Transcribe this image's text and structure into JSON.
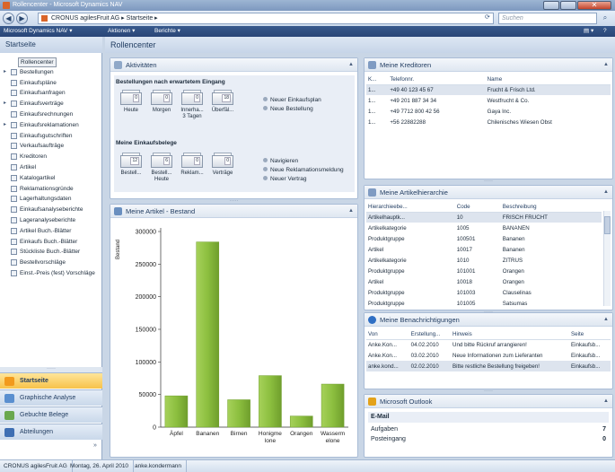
{
  "window": {
    "title": "Rollencenter - Microsoft Dynamics NAV"
  },
  "address": {
    "path": "CRONUS agilesFruit AG  ▸  Startseite  ▸",
    "search_placeholder": "Suchen"
  },
  "commandbar": {
    "app": "Microsoft Dynamics NAV ▾",
    "actions": "Aktionen ▾",
    "reports": "Berichte ▾"
  },
  "leftpane": {
    "title": "Startseite",
    "items": [
      {
        "label": "Rollencenter",
        "arrow": ""
      },
      {
        "label": "Bestellungen",
        "arrow": "▸"
      },
      {
        "label": "Einkaufspläne",
        "arrow": ""
      },
      {
        "label": "Einkaufsanfragen",
        "arrow": ""
      },
      {
        "label": "Einkaufsverträge",
        "arrow": "▸"
      },
      {
        "label": "Einkaufsrechnungen",
        "arrow": ""
      },
      {
        "label": "Einkaufsreklamationen",
        "arrow": "▸"
      },
      {
        "label": "Einkaufsgutschriften",
        "arrow": ""
      },
      {
        "label": "Verkaufsaufträge",
        "arrow": ""
      },
      {
        "label": "Kreditoren",
        "arrow": ""
      },
      {
        "label": "Artikel",
        "arrow": ""
      },
      {
        "label": "Katalogartikel",
        "arrow": ""
      },
      {
        "label": "Reklamationsgründe",
        "arrow": ""
      },
      {
        "label": "Lagerhaltungsdaten",
        "arrow": ""
      },
      {
        "label": "Einkaufsanalyseberichte",
        "arrow": ""
      },
      {
        "label": "Lageranalyseberichte",
        "arrow": ""
      },
      {
        "label": "Artikel Buch.-Blätter",
        "arrow": ""
      },
      {
        "label": "Einkaufs Buch.-Blätter",
        "arrow": ""
      },
      {
        "label": "Stückliste Buch.-Blätter",
        "arrow": ""
      },
      {
        "label": "Bestellvorschläge",
        "arrow": ""
      },
      {
        "label": "Einst.-Preis (fest) Vorschläge",
        "arrow": ""
      }
    ],
    "groups": [
      {
        "label": "Startseite",
        "color": "#f29a1c"
      },
      {
        "label": "Graphische Analyse",
        "color": "#5a8fcf"
      },
      {
        "label": "Gebuchte Belege",
        "color": "#6aa84f"
      },
      {
        "label": "Abteilungen",
        "color": "#3f6fb3"
      }
    ]
  },
  "content": {
    "title": "Rollencenter"
  },
  "activities": {
    "title": "Aktivitäten",
    "section1": "Bestellungen nach erwartetem Eingang",
    "cues1": [
      {
        "label": "Heute",
        "value": "0"
      },
      {
        "label": "Morgen",
        "value": "0"
      },
      {
        "label": "Innerha... 3 Tagen",
        "value": "0"
      },
      {
        "label": "Überfäl...",
        "value": "18"
      }
    ],
    "actions1": [
      "Neuer Einkaufsplan",
      "Neue Bestellung"
    ],
    "section2": "Meine Einkaufsbelege",
    "cues2": [
      {
        "label": "Bestell...",
        "value": "12"
      },
      {
        "label": "Bestell... Heute",
        "value": "6"
      },
      {
        "label": "Reklam...",
        "value": "0"
      },
      {
        "label": "Verträge",
        "value": "0"
      }
    ],
    "actions2": [
      "Navigieren",
      "Neue Reklamationsmeldung",
      "Neuer Vertrag"
    ]
  },
  "vendors": {
    "title": "Meine Kreditoren",
    "columns": [
      "K...",
      "Telefonnr.",
      "Name"
    ],
    "rows": [
      [
        "1...",
        "+49 40 123 45 67",
        "Frucht & Frisch Ltd."
      ],
      [
        "1...",
        "+49 201 887 34 34",
        "Westfrucht & Co."
      ],
      [
        "1...",
        "+49 7712 800 42 56",
        "Gaya Inc."
      ],
      [
        "1...",
        "+56 22882288",
        "Chilenisches Wiesen Obst"
      ]
    ]
  },
  "hierarchy": {
    "title": "Meine Artikelhierarchie",
    "columns": [
      "Hierarchieebe...",
      "Code",
      "Beschreibung"
    ],
    "rows": [
      [
        "Artikelhauptk...",
        "10",
        "FRISCH FRUCHT"
      ],
      [
        "Artikelkategorie",
        "1005",
        "BANANEN"
      ],
      [
        "Produktgruppe",
        "100501",
        "Bananen"
      ],
      [
        "Artikel",
        "10017",
        "Bananen"
      ],
      [
        "Artikelkategorie",
        "1010",
        "ZITRUS"
      ],
      [
        "Produktgruppe",
        "101001",
        "Orangen"
      ],
      [
        "Artikel",
        "10018",
        "Orangen"
      ],
      [
        "Produktgruppe",
        "101003",
        "Clauselinas"
      ],
      [
        "Produktgruppe",
        "101005",
        "Satsumas"
      ]
    ]
  },
  "notifications": {
    "title": "Meine Benachrichtigungen",
    "columns": [
      "Von",
      "Erstellung...",
      "Hinweis",
      "Seite"
    ],
    "rows": [
      [
        "Anke.Kon...",
        "04.02.2010",
        "Und bitte Rückruf arrangieren!",
        "Einkaufsb..."
      ],
      [
        "Anke.Kon...",
        "03.02.2010",
        "Neue Informationen zum Lieferanten",
        "Einkaufsb..."
      ],
      [
        "anke.kond...",
        "02.02.2010",
        "Bitte restliche Bestellung freigeben!",
        "Einkaufsb..."
      ]
    ]
  },
  "outlook": {
    "title": "Microsoft Outlook",
    "section": "E-Mail",
    "rows": [
      [
        "Aufgaben",
        "7"
      ],
      [
        "Posteingang",
        "0"
      ]
    ]
  },
  "chart_title": "Meine Artikel - Bestand",
  "chart_data": {
    "type": "bar",
    "categories": [
      "Äpfel",
      "Bananen",
      "Birnen",
      "Honigmelone",
      "Orangen",
      "Wassermelone"
    ],
    "category_labels": [
      [
        "Äpfel"
      ],
      [
        "Bananen"
      ],
      [
        "Birnen"
      ],
      [
        "Honigme",
        "lone"
      ],
      [
        "Orangen"
      ],
      [
        "Wasserm",
        "elone"
      ]
    ],
    "values": [
      48000,
      284000,
      42000,
      79000,
      17000,
      66000
    ],
    "ylabel": "Bestand",
    "ylim": [
      0,
      300000
    ],
    "yticks": [
      0,
      50000,
      100000,
      150000,
      200000,
      250000,
      300000
    ],
    "ytick_labels": [
      "0",
      "50000",
      "100000",
      "150000",
      "200000",
      "250000",
      "300000"
    ],
    "grid": false,
    "bar_color": "#8cbf3f"
  },
  "status": {
    "company": "CRONUS agilesFruit AG",
    "date": "Montag, 26. April 2010",
    "user": "anke.kondermann"
  }
}
